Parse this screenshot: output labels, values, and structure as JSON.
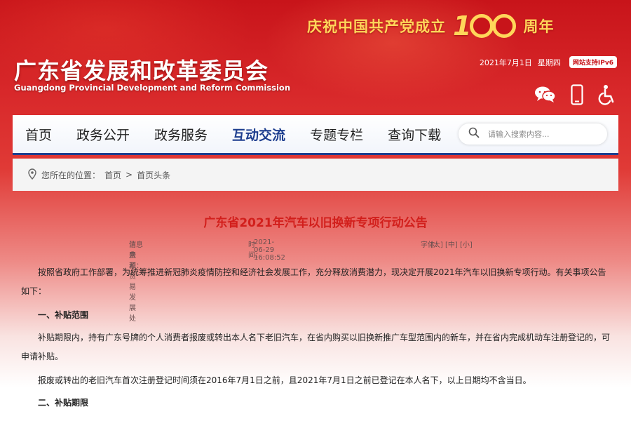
{
  "banner": {
    "celebrate_prefix": "庆祝中国共产党成立",
    "celebrate_number": "100",
    "celebrate_suffix": "周年",
    "site_name_cn": "广东省发展和改革委员会",
    "site_name_en": "Guangdong Provincial Development and Reform Commission",
    "date": "2021年7月1日",
    "weekday": "星期四",
    "ipv6_badge": "网站支持IPv6",
    "icons": [
      "wechat-icon",
      "mobile-icon",
      "accessibility-icon"
    ]
  },
  "nav": {
    "items": [
      {
        "label": "首页"
      },
      {
        "label": "政务公开"
      },
      {
        "label": "政务服务"
      },
      {
        "label": "互动交流"
      },
      {
        "label": "专题专栏"
      },
      {
        "label": "查询下载"
      }
    ],
    "active": "互动交流",
    "search_placeholder": "请输入搜索内容..."
  },
  "breadcrumb": {
    "prefix": "您所在的位置：",
    "items": [
      "首页",
      "首页头条"
    ],
    "separator": ">"
  },
  "article": {
    "title": "广东省2021年汽车以旧换新专项行动公告",
    "source_label": "信息来源：",
    "source": "消费和贸易发展处",
    "time_label": "时间：",
    "time": "2021-06-29 16:08:52",
    "font_label": "字体：",
    "font_sizes": [
      "[大]",
      "[中]",
      "[小]"
    ],
    "intro": "按照省政府工作部署，为统筹推进新冠肺炎疫情防控和经济社会发展工作，充分释放消费潜力，现决定开展2021年汽车以旧换新专项行动。有关事项公告如下：",
    "section1_heading": "一、补贴范围",
    "section1_p1": "补贴期限内，持有广东号牌的个人消费者报废或转出本人名下老旧汽车，在省内购买以旧换新推广车型范围内的新车，并在省内完成机动车注册登记的，可申请补贴。",
    "section1_p2": "报废或转出的老旧汽车首次注册登记时间须在2016年7月1日之前，且2021年7月1日之前已登记在本人名下，以上日期均不含当日。",
    "section2_heading": "二、补贴期限"
  },
  "colors": {
    "brand_red": "#c8141a",
    "title_red": "#d21f1c",
    "nav_blue": "#1f3f8f",
    "gold": "#ffd65a"
  }
}
